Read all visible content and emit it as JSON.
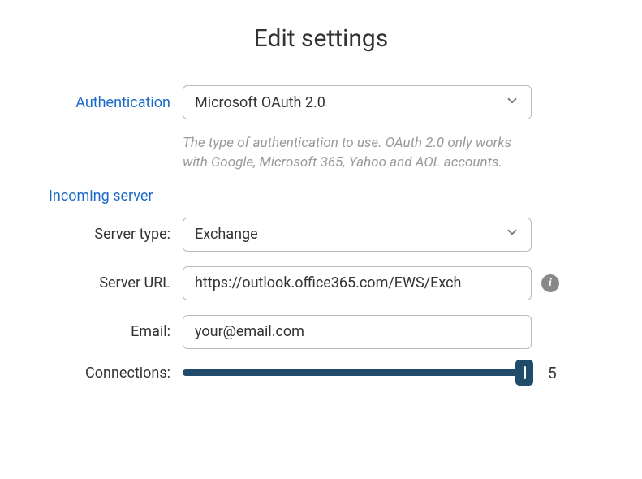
{
  "title": "Edit settings",
  "auth": {
    "label": "Authentication",
    "value": "Microsoft OAuth 2.0",
    "help": "The type of authentication to use. OAuth 2.0 only works with Google, Microsoft 365, Yahoo and AOL accounts."
  },
  "incoming": {
    "header": "Incoming server",
    "server_type_label": "Server type:",
    "server_type_value": "Exchange",
    "server_url_label": "Server URL",
    "server_url_value": "https://outlook.office365.com/EWS/Exch",
    "email_label": "Email:",
    "email_value": "your@email.com",
    "connections_label": "Connections:",
    "connections_value": "5"
  }
}
